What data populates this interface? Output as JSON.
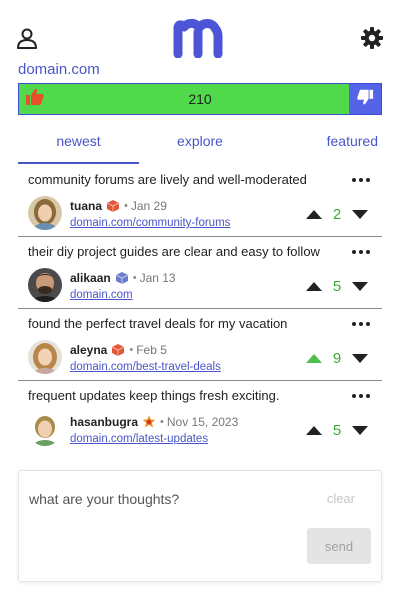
{
  "header": {
    "user_icon": "user-icon",
    "logo_icon": "m-logo",
    "settings_icon": "gear-icon",
    "logo_color": "#4b55d6"
  },
  "site": {
    "domain": "domain.com"
  },
  "vote_bar": {
    "count": "210",
    "up_color": "#4fd94b",
    "down_color": "#5564e6",
    "up_icon": "thumbs-up-icon",
    "down_icon": "thumbs-down-icon"
  },
  "tabs": [
    {
      "label": "newest",
      "active": true
    },
    {
      "label": "explore",
      "active": false
    },
    {
      "label": "featured",
      "active": false
    }
  ],
  "posts": [
    {
      "title": "community forums are lively and well-moderated",
      "author": "tuana",
      "badge": "red-cube-badge",
      "date": "Jan 29",
      "link": "domain.com/community-forums",
      "score": "2",
      "upvoted": false
    },
    {
      "title": "their diy project guides are clear and easy to follow",
      "author": "alikaan",
      "badge": "blue-cube-badge",
      "date": "Jan 13",
      "link": "domain.com",
      "score": "5",
      "upvoted": false
    },
    {
      "title": "found the perfect travel deals for my vacation",
      "author": "aleyna",
      "badge": "red-cube-badge",
      "date": "Feb 5",
      "link": "domain.com/best-travel-deals",
      "score": "9",
      "upvoted": true
    },
    {
      "title": "frequent updates keep things fresh exciting.",
      "author": "hasanbugra",
      "badge": "orange-star-badge",
      "date": "Nov 15, 2023",
      "link": "domain.com/latest-updates",
      "score": "5",
      "upvoted": false
    }
  ],
  "composer": {
    "placeholder": "what are your thoughts?",
    "clear_label": "clear",
    "send_label": "send"
  },
  "dot_separator": "•"
}
